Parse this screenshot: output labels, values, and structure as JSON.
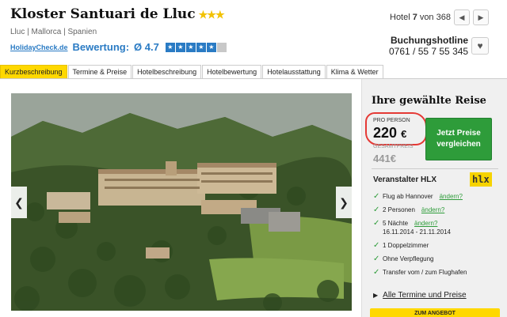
{
  "hotel": {
    "name": "Kloster Santuari de Lluc",
    "stars": "★★★",
    "location": "Lluc | Mallorca | Spanien"
  },
  "rating": {
    "logo": "HolidayCheck.de",
    "label": "Bewertung:",
    "score": "Ø 4.7",
    "boxes": [
      "★",
      "★",
      "★",
      "★",
      "★",
      ""
    ]
  },
  "nav": {
    "prefix": "Hotel",
    "current": "7",
    "separator": "von",
    "total": "368",
    "prev_icon": "◀",
    "next_icon": "▶"
  },
  "hotline": {
    "label": "Buchungshotline",
    "number": "0761 / 55 7 55 345",
    "heart_icon": "♥"
  },
  "tabs": [
    {
      "label": "Kurzbeschreibung",
      "active": true
    },
    {
      "label": "Termine & Preise",
      "active": false
    },
    {
      "label": "Hotelbeschreibung",
      "active": false
    },
    {
      "label": "Hotelbewertung",
      "active": false
    },
    {
      "label": "Hotelausstattung",
      "active": false
    },
    {
      "label": "Klima & Wetter",
      "active": false
    }
  ],
  "gallery": {
    "prev_icon": "❮",
    "next_icon": "❯"
  },
  "trip": {
    "title": "Ihre gewählte Reise",
    "per_person_label": "PRO PERSON",
    "price": "220",
    "currency": "€",
    "total_label": "GESAMTPREIS",
    "total_price": "441",
    "total_currency": "€",
    "cta": "Jetzt Preise vergleichen",
    "operator_label": "Veranstalter HLX",
    "operator_logo": "hlx",
    "features": [
      {
        "text": "Flug ab Hannover",
        "link": "ändern?",
        "dates": ""
      },
      {
        "text": "2 Personen",
        "link": "ändern?",
        "dates": ""
      },
      {
        "text": "5 Nächte",
        "link": "ändern?",
        "dates": "16.11.2014 - 21.11.2014"
      },
      {
        "text": "1 Doppelzimmer",
        "link": "",
        "dates": ""
      },
      {
        "text": "Ohne Verpflegung",
        "link": "",
        "dates": ""
      },
      {
        "text": "Transfer vom / zum Flughafen",
        "link": "",
        "dates": ""
      }
    ],
    "all_dates_link": "Alle Termine und Preise",
    "bottom_button": "ZUM ANGEBOT"
  },
  "colors": {
    "accent_yellow": "#ffd800",
    "cta_green": "#2e9c3a",
    "brand_blue": "#2a7bc4",
    "highlight_red": "#e53935"
  }
}
